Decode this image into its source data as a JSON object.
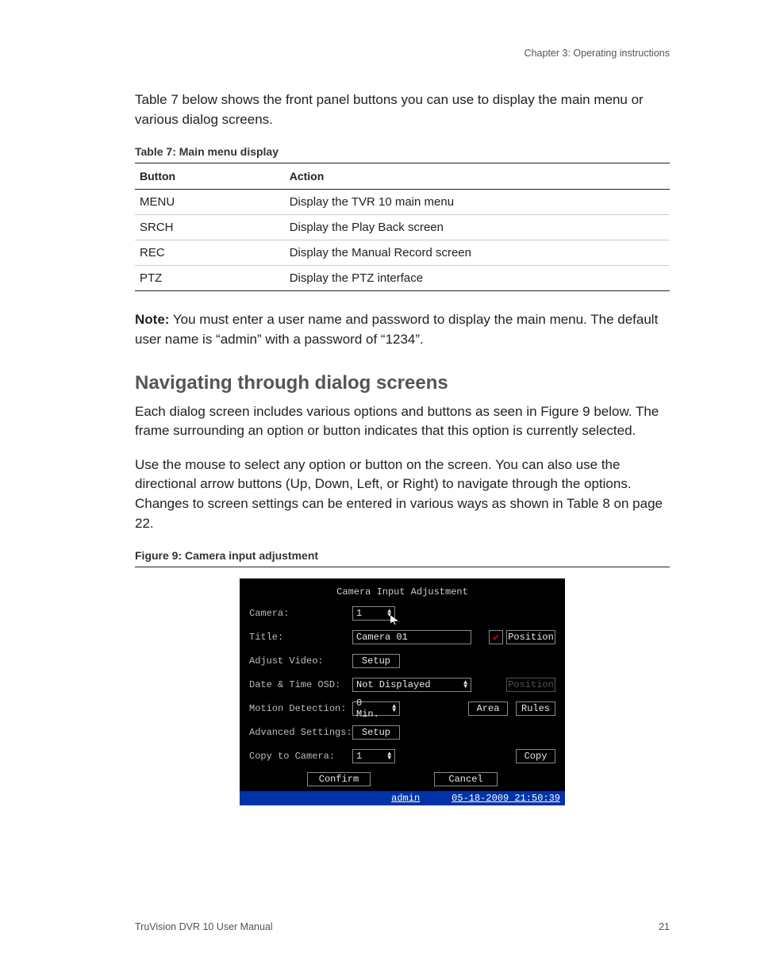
{
  "header": {
    "chapter": "Chapter 3: Operating instructions"
  },
  "intro": "Table 7 below shows the front panel buttons you can use to display the main menu or various dialog screens.",
  "table7": {
    "caption": "Table 7: Main menu display",
    "head": {
      "c0": "Button",
      "c1": "Action"
    },
    "rows": [
      {
        "btn": "MENU",
        "act": "Display the TVR 10 main menu"
      },
      {
        "btn": "SRCH",
        "act": "Display the Play Back screen"
      },
      {
        "btn": "REC",
        "act": "Display the Manual Record screen"
      },
      {
        "btn": "PTZ",
        "act": "Display the PTZ interface"
      }
    ]
  },
  "note": {
    "label": "Note:",
    "text": " You must enter a user name and password to display the main menu. The default user name is “admin” with a password of “1234”."
  },
  "section_heading": "Navigating through dialog screens",
  "para1": "Each dialog screen includes various options and buttons as seen in Figure 9 below. The frame surrounding an option or button indicates that this option is currently selected.",
  "para2": "Use the mouse to select any option or button on the screen. You can also use the directional arrow buttons (Up, Down, Left, or Right) to navigate through the options. Changes to screen settings can be entered in various ways as shown in Table 8 on page 22.",
  "figure9_caption": "Figure 9: Camera input adjustment",
  "dvr": {
    "title": "Camera Input Adjustment",
    "labels": {
      "camera": "Camera:",
      "title": "Title:",
      "adjust": "Adjust Video:",
      "osd": "Date & Time OSD:",
      "motion": "Motion Detection:",
      "advanced": "Advanced Settings:",
      "copy": "Copy to Camera:"
    },
    "values": {
      "camera": "1",
      "title": "Camera 01",
      "osd": "Not Displayed",
      "motion": "0 Min.",
      "copy": "1"
    },
    "buttons": {
      "position": "Position",
      "setup": "Setup",
      "area": "Area",
      "rules": "Rules",
      "copy": "Copy",
      "confirm": "Confirm",
      "cancel": "Cancel"
    },
    "status": {
      "user": "admin",
      "datetime": "05-18-2009 21:50:39"
    }
  },
  "footer": {
    "manual": "TruVision DVR 10 User Manual",
    "page": "21"
  }
}
